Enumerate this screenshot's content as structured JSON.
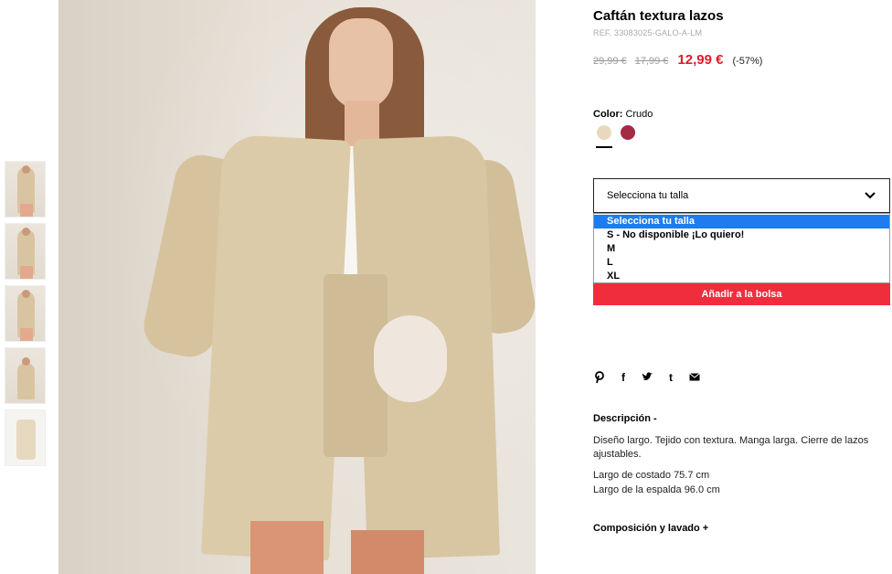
{
  "product": {
    "title": "Caftán textura lazos",
    "ref": "REF. 33083025-GALO-A-LM",
    "price_original": "29,99 €",
    "price_previous": "17,99 €",
    "price_sale": "12,99 €",
    "discount": "(-57%)"
  },
  "color": {
    "label": "Color:",
    "value": "Crudo",
    "swatches": [
      {
        "name": "crudo",
        "hex": "#e7d9bd",
        "selected": true
      },
      {
        "name": "burgundy",
        "hex": "#a52a44",
        "selected": false
      }
    ]
  },
  "size": {
    "select_label": "Selecciona tu talla",
    "options": [
      {
        "label": "Selecciona tu talla",
        "highlighted": true
      },
      {
        "label": "S - No disponible ¡Lo quiero!",
        "highlighted": false
      },
      {
        "label": "M",
        "highlighted": false
      },
      {
        "label": "L",
        "highlighted": false
      },
      {
        "label": "XL",
        "highlighted": false
      }
    ]
  },
  "add_to_bag": "Añadir a la bolsa",
  "share_icons": [
    "pinterest-icon",
    "facebook-icon",
    "twitter-icon",
    "tumblr-icon",
    "email-icon"
  ],
  "share_glyphs": [
    "℗",
    "f",
    "🐦",
    "t",
    "✉"
  ],
  "description": {
    "heading": "Descripción -",
    "text": "Diseño largo. Tejido con textura. Manga larga. Cierre de lazos ajustables.",
    "measure1": "Largo de costado 75.7 cm",
    "measure2": "Largo de la espalda 96.0 cm"
  },
  "composition_heading": "Composición y lavado +",
  "colors": {
    "sale_red": "#e11a2b",
    "button_red": "#ef2d3d",
    "select_blue": "#1e7cf0"
  }
}
